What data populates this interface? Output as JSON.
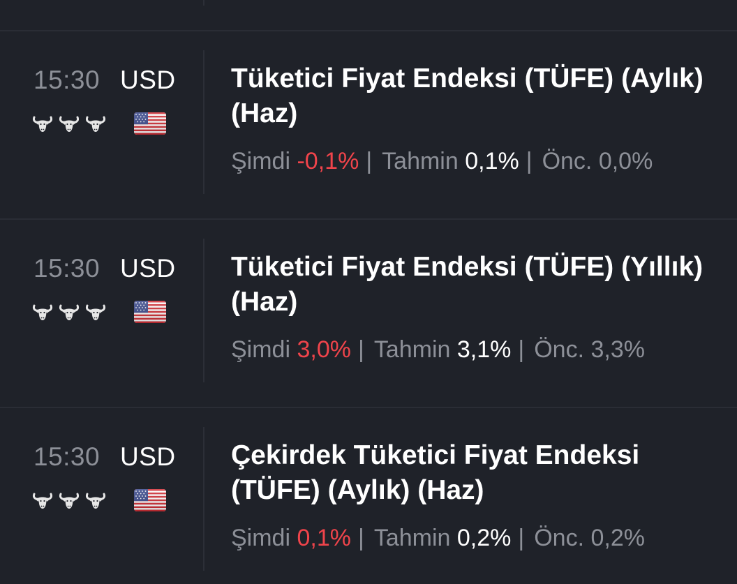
{
  "labels": {
    "actual": "Şimdi",
    "forecast": "Tahmin",
    "previous": "Önc.",
    "separator": "|"
  },
  "colors": {
    "background": "#1f2229",
    "actual_value": "#f0444b",
    "muted": "#8d9098"
  },
  "events": [
    {
      "time": "15:30",
      "currency": "USD",
      "importance": 3,
      "flag": "us-flag-icon",
      "title": "Tüketici Fiyat Endeksi (TÜFE) (Aylık) (Haz)",
      "actual": "-0,1%",
      "forecast": "0,1%",
      "previous": "0,0%"
    },
    {
      "time": "15:30",
      "currency": "USD",
      "importance": 3,
      "flag": "us-flag-icon",
      "title": "Tüketici Fiyat Endeksi (TÜFE) (Yıllık) (Haz)",
      "actual": "3,0%",
      "forecast": "3,1%",
      "previous": "3,3%"
    },
    {
      "time": "15:30",
      "currency": "USD",
      "importance": 3,
      "flag": "us-flag-icon",
      "title": "Çekirdek Tüketici Fiyat Endeksi (TÜFE) (Aylık) (Haz)",
      "actual": "0,1%",
      "forecast": "0,2%",
      "previous": "0,2%"
    }
  ]
}
